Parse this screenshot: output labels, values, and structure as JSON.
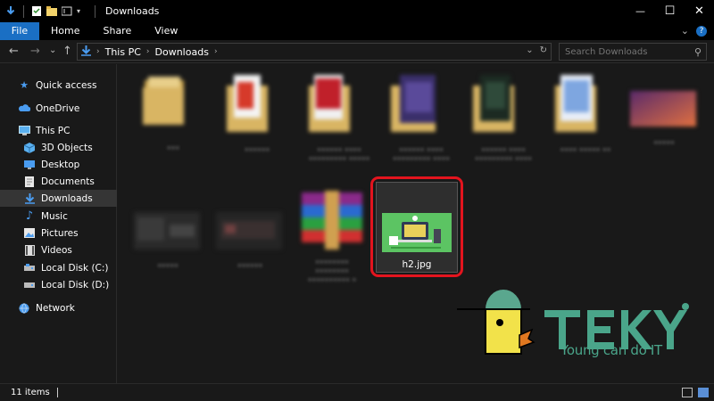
{
  "window": {
    "title": "Downloads",
    "minimize_glyph": "—",
    "maximize_glyph": "☐",
    "close_glyph": "✕"
  },
  "ribbon": {
    "tabs": [
      "File",
      "Home",
      "Share",
      "View"
    ],
    "expand_glyph": "⌄",
    "help_glyph": "?"
  },
  "nav": {
    "back_glyph": "←",
    "forward_glyph": "→",
    "recent_glyph": "⌄",
    "up_glyph": "↑",
    "breadcrumb": [
      "This PC",
      "Downloads"
    ],
    "refresh_glyph": "↻"
  },
  "search": {
    "placeholder": "Search Downloads",
    "icon": "search-icon"
  },
  "sidebar": {
    "items": [
      {
        "label": "Quick access",
        "icon": "star-icon"
      },
      {
        "label": "OneDrive",
        "icon": "cloud-icon"
      },
      {
        "label": "This PC",
        "icon": "computer-icon"
      },
      {
        "label": "3D Objects",
        "icon": "cube-icon"
      },
      {
        "label": "Desktop",
        "icon": "desktop-icon"
      },
      {
        "label": "Documents",
        "icon": "document-icon"
      },
      {
        "label": "Downloads",
        "icon": "download-icon",
        "selected": true
      },
      {
        "label": "Music",
        "icon": "music-icon"
      },
      {
        "label": "Pictures",
        "icon": "picture-icon"
      },
      {
        "label": "Videos",
        "icon": "video-icon"
      },
      {
        "label": "Local Disk (C:)",
        "icon": "drive-icon"
      },
      {
        "label": "Local Disk (D:)",
        "icon": "drive-icon"
      },
      {
        "label": "Network",
        "icon": "network-icon"
      }
    ]
  },
  "files": {
    "selected_name": "h2.jpg"
  },
  "status": {
    "count_text": "11 items"
  },
  "watermark": {
    "brand": "TEKY",
    "slogan": "Young can do IT"
  },
  "colors": {
    "accent": "#1a6fc4",
    "highlight_ring": "#e3141e",
    "brand_green": "#4aa58a",
    "brand_yellow": "#f2e24a"
  }
}
